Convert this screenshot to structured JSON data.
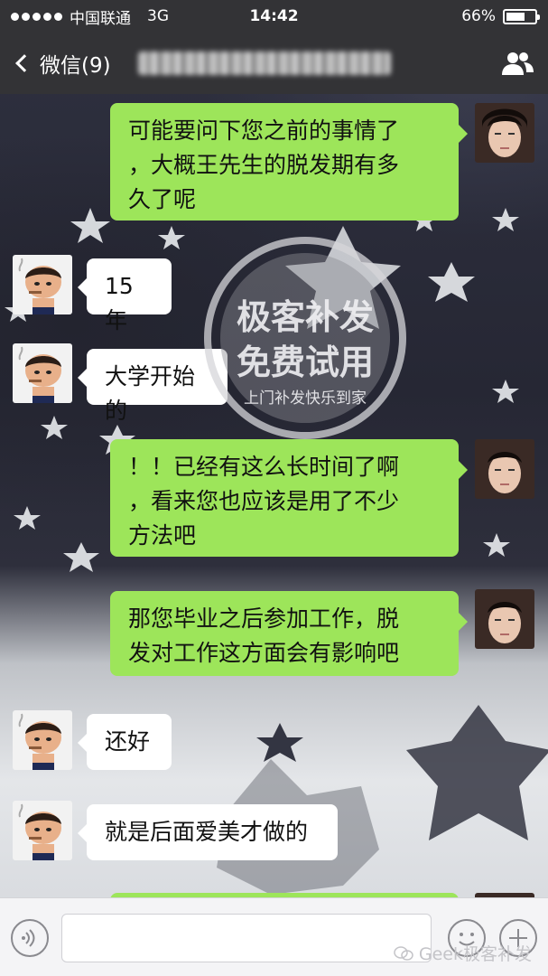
{
  "status_bar": {
    "carrier": "中国联通",
    "network": "3G",
    "time": "14:42",
    "battery": "66%",
    "battery_level": 0.66
  },
  "nav_bar": {
    "back_label": "微信(9)"
  },
  "messages": [
    {
      "side": "right",
      "text_lines": [
        "可能要问下您之前的事情了",
        "，大概王先生的脱发期有多",
        "久了呢"
      ]
    },
    {
      "side": "left",
      "text_lines": [
        "15年"
      ]
    },
    {
      "side": "left",
      "text_lines": [
        "大学开始的"
      ]
    },
    {
      "side": "right",
      "text_lines": [
        "！！已经有这么长时间了啊",
        "，看来您也应该是用了不少",
        "方法吧"
      ]
    },
    {
      "side": "right",
      "text_lines": [
        "那您毕业之后参加工作，脱",
        "发对工作这方面会有影响吧"
      ]
    },
    {
      "side": "left",
      "text_lines": [
        "还好"
      ]
    },
    {
      "side": "left",
      "text_lines": [
        "就是后面爱美才做的"
      ]
    }
  ],
  "watermark": {
    "line1": "极客补发",
    "line2": "免费试用",
    "line3": "上门补发快乐到家"
  },
  "footer": {
    "text": "Geek极客补发"
  },
  "colors": {
    "bar": "#333336",
    "bubble_right": "#9de55a",
    "bubble_left": "#ffffff"
  },
  "icons": [
    "back-chevron-icon",
    "group-members-icon",
    "voice-icon",
    "emoji-icon",
    "plus-icon",
    "wechat-logo-icon"
  ]
}
